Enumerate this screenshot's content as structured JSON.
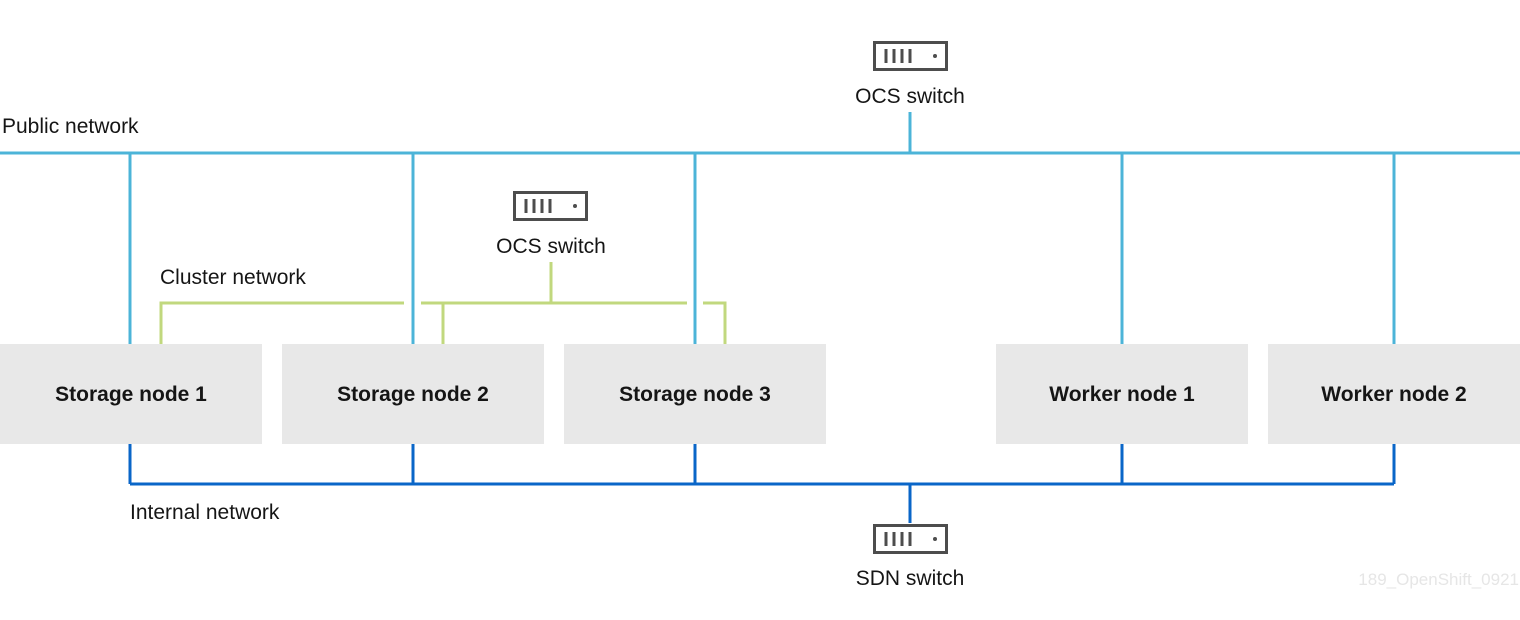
{
  "colors": {
    "public": "#4cb4d8",
    "cluster": "#c1d87e",
    "internal": "#0a66c8",
    "node_fill": "#e8e8e8",
    "icon": "#4d4d4d"
  },
  "networks": {
    "public": "Public network",
    "cluster": "Cluster network",
    "internal": "Internal network"
  },
  "switches": {
    "public": {
      "label": "OCS switch",
      "icon": "network-switch-icon"
    },
    "cluster": {
      "label": "OCS switch",
      "icon": "network-switch-icon"
    },
    "internal": {
      "label": "SDN switch",
      "icon": "network-switch-icon"
    }
  },
  "nodes": [
    {
      "label": "Storage node 1"
    },
    {
      "label": "Storage node 2"
    },
    {
      "label": "Storage node 3"
    },
    {
      "label": "Worker node 1"
    },
    {
      "label": "Worker node 2"
    }
  ],
  "watermark": "189_OpenShift_0921"
}
